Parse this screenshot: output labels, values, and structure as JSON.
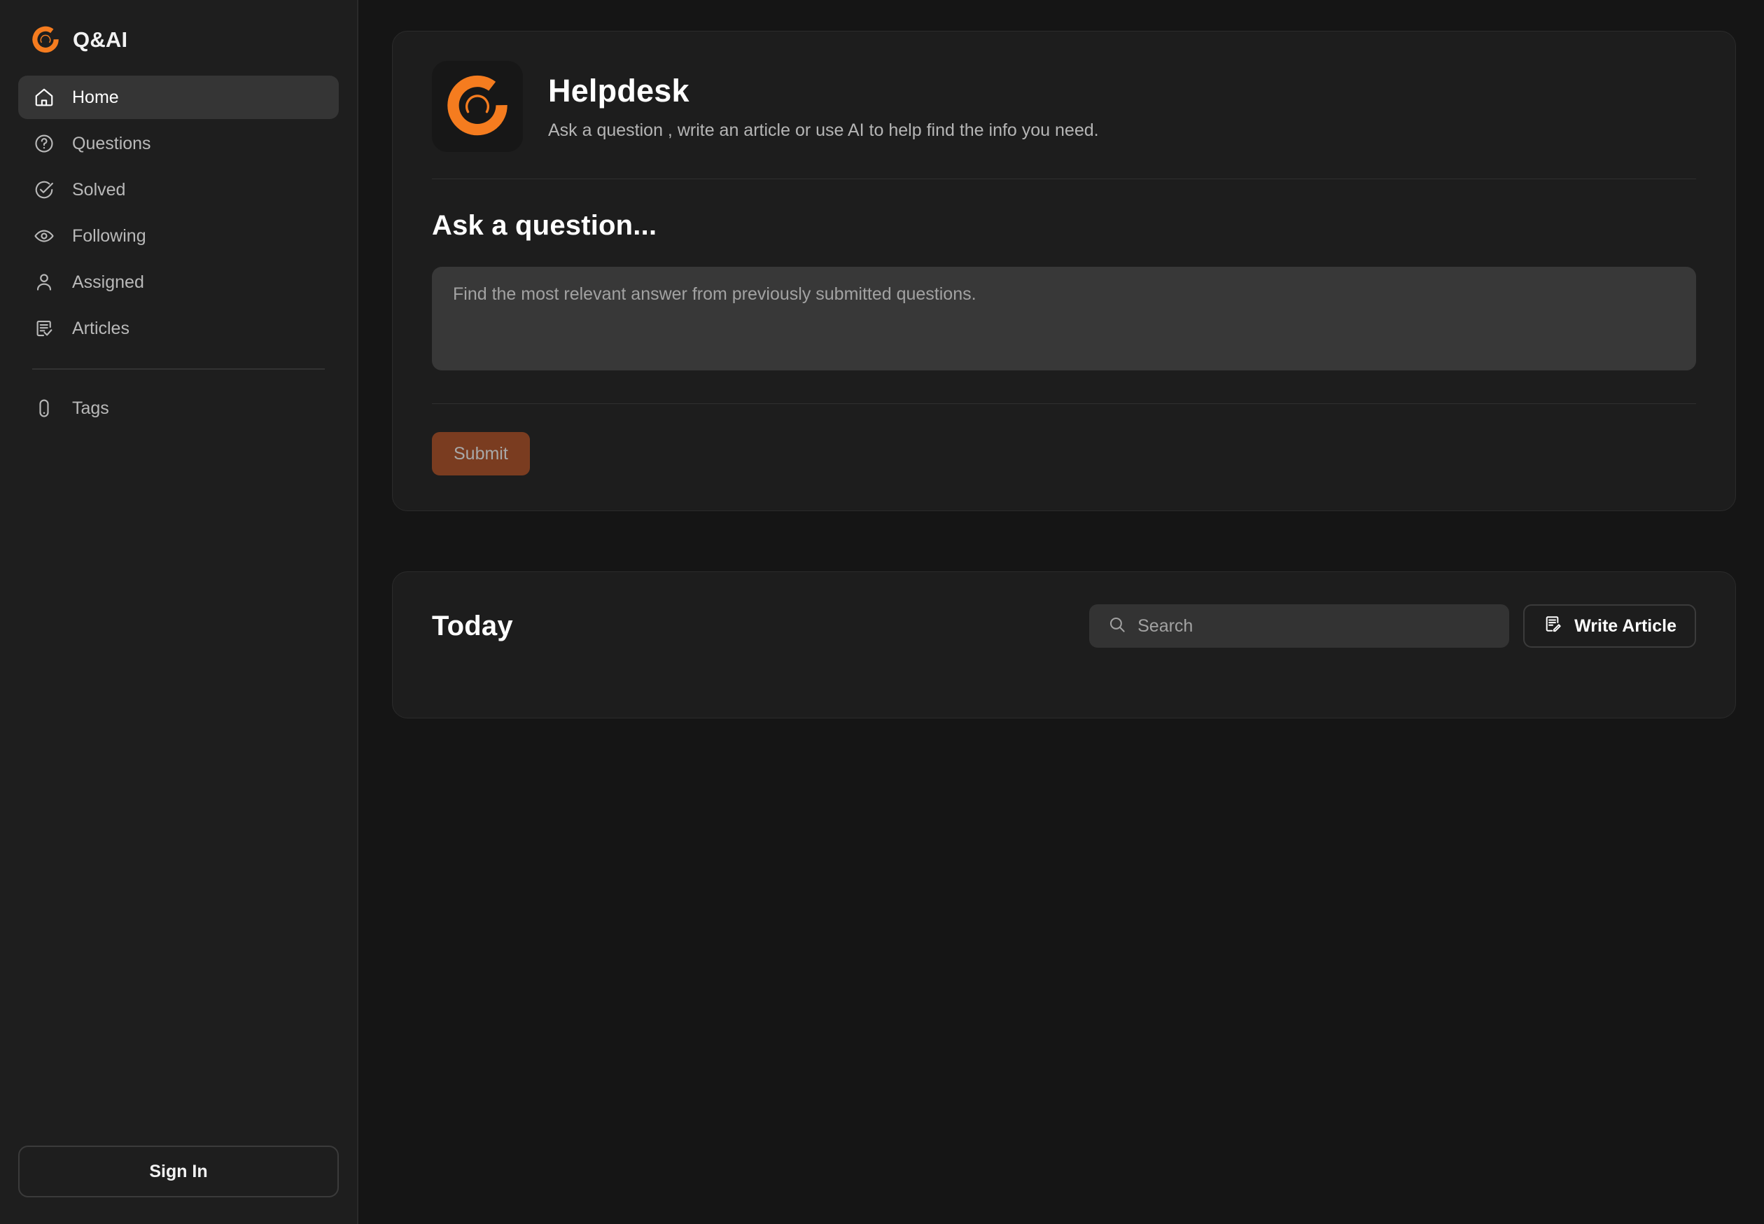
{
  "brand": {
    "name": "Q&AI",
    "logo_icon": "qai-arc-logo",
    "accent_color": "#F57C1F"
  },
  "sidebar": {
    "items": [
      {
        "label": "Home",
        "icon": "home-icon",
        "active": true
      },
      {
        "label": "Questions",
        "icon": "question-mark-circle-icon",
        "active": false
      },
      {
        "label": "Solved",
        "icon": "check-circle-icon",
        "active": false
      },
      {
        "label": "Following",
        "icon": "eye-icon",
        "active": false
      },
      {
        "label": "Assigned",
        "icon": "user-icon",
        "active": false
      },
      {
        "label": "Articles",
        "icon": "document-check-icon",
        "active": false
      }
    ],
    "secondary_items": [
      {
        "label": "Tags",
        "icon": "tag-icon",
        "active": false
      }
    ],
    "sign_in_label": "Sign In"
  },
  "header": {
    "logo_icon": "qai-arc-logo",
    "title": "Helpdesk",
    "subtitle": "Ask a question , write an article or use AI to help find the info you need."
  },
  "ask": {
    "heading": "Ask a question...",
    "input_value": "",
    "input_placeholder": "Find the most relevant answer from previously submitted questions.",
    "submit_label": "Submit",
    "submit_color": "#7A3C20"
  },
  "today": {
    "title": "Today",
    "search_value": "",
    "search_placeholder": "Search",
    "search_icon": "search-icon",
    "write_article_label": "Write Article",
    "write_article_icon": "document-pencil-icon"
  }
}
